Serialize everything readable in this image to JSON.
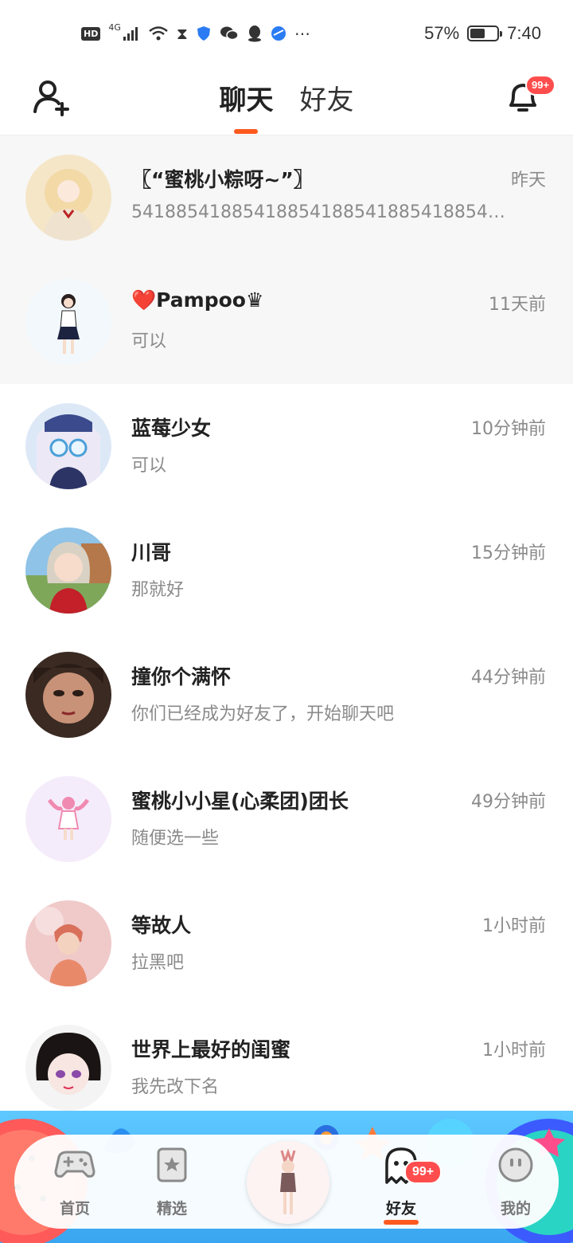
{
  "status_bar": {
    "hd": "HD",
    "network": "4G",
    "battery_percent_text": "57%",
    "battery_level": 0.57,
    "time": "7:40"
  },
  "header": {
    "tabs": [
      {
        "label": "聊天",
        "active": true
      },
      {
        "label": "好友",
        "active": false
      }
    ],
    "notification_badge": "99+"
  },
  "chats": [
    {
      "name": "〖“蜜桃小粽呀~”〗",
      "message": "541885418854188541885418854188541885418854…",
      "time": "昨天",
      "pinned": true
    },
    {
      "name_prefix": "❤️",
      "name": "Pampoo♛",
      "message": "可以",
      "time": "11天前",
      "pinned": true
    },
    {
      "name": "蓝莓少女",
      "message": "可以",
      "time": "10分钟前",
      "pinned": false
    },
    {
      "name": "川哥",
      "message": "那就好",
      "time": "15分钟前",
      "pinned": false
    },
    {
      "name": "撞你个满怀",
      "message": "你们已经成为好友了，开始聊天吧",
      "time": "44分钟前",
      "pinned": false
    },
    {
      "name": "蜜桃小小星(心柔团)团长",
      "message": "随便选一些",
      "time": "49分钟前",
      "pinned": false
    },
    {
      "name": "等故人",
      "message": "拉黑吧",
      "time": "1小时前",
      "pinned": false
    },
    {
      "name": "世界上最好的闺蜜",
      "message": "我先改下名",
      "time": "1小时前",
      "pinned": false
    }
  ],
  "bottom_nav": {
    "items": [
      {
        "label": "首页",
        "icon": "gamepad-icon",
        "active": false
      },
      {
        "label": "精选",
        "icon": "star-card-icon",
        "active": false
      },
      {
        "label": "好友",
        "icon": "ghost-icon",
        "active": true
      },
      {
        "label": "我的",
        "icon": "face-icon",
        "active": false
      }
    ],
    "friends_badge": "99+"
  },
  "colors": {
    "accent": "#ff5a1f",
    "badge": "#ff4d4d",
    "pinned_bg": "#f7f7f7",
    "nav_bg": "#3aa6f0"
  }
}
